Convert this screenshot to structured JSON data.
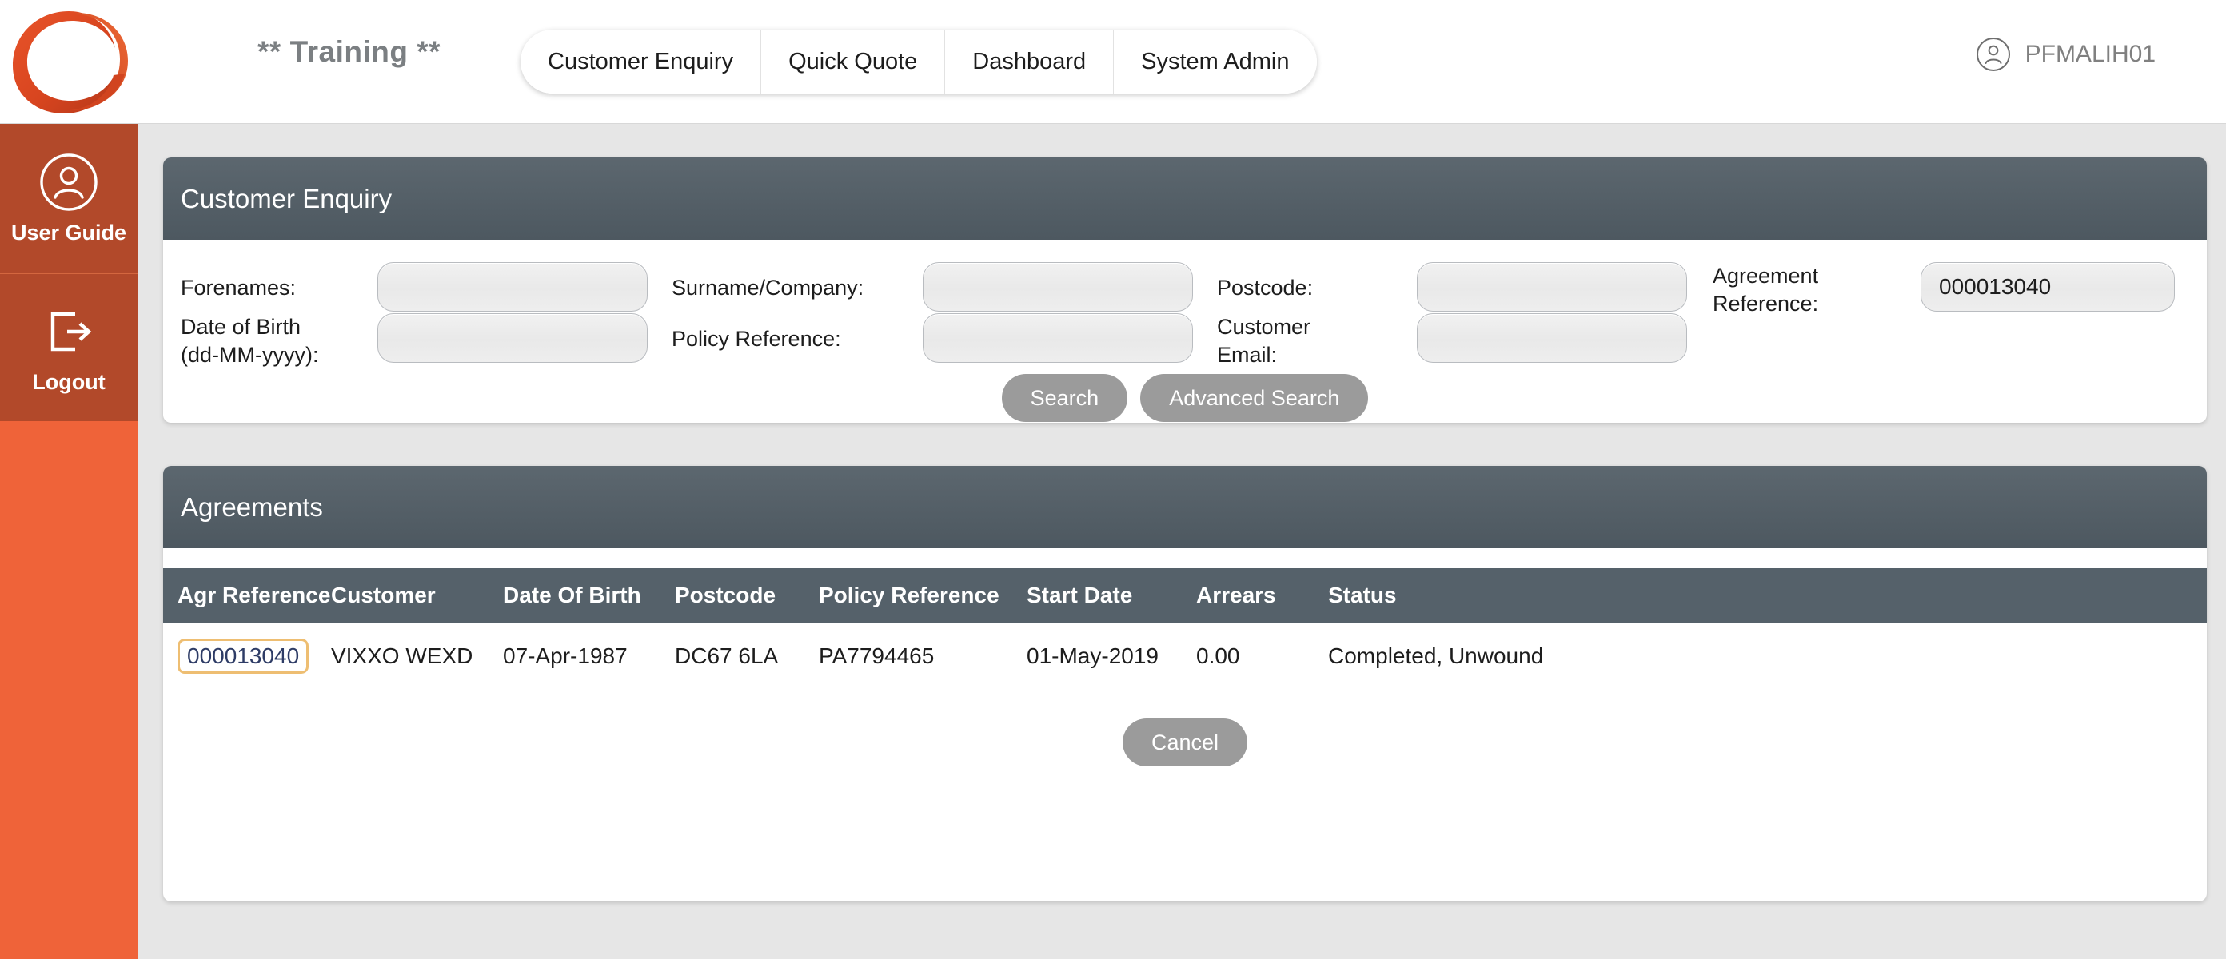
{
  "header": {
    "logo_icon": "swirl-ring-logo",
    "training_title": "** Training **",
    "tabs": [
      {
        "label": "Customer Enquiry"
      },
      {
        "label": "Quick Quote"
      },
      {
        "label": "Dashboard"
      },
      {
        "label": "System Admin"
      }
    ],
    "user": {
      "icon": "user-circle-icon",
      "name": "PFMALIH01"
    }
  },
  "sidebar": {
    "items": [
      {
        "label": "User Guide",
        "icon": "user-circle-icon"
      },
      {
        "label": "Logout",
        "icon": "logout-arrow-icon"
      }
    ],
    "background_color": "#ef6339",
    "item_color": "#b2492a"
  },
  "enquiry": {
    "title": "Customer Enquiry",
    "fields": [
      {
        "label": "Forenames:",
        "value": "",
        "placeholder": ""
      },
      {
        "label": "Surname/Company:",
        "value": "",
        "placeholder": ""
      },
      {
        "label": "Postcode:",
        "value": "",
        "placeholder": ""
      },
      {
        "label": "Agreement Reference:",
        "value": "000013040",
        "placeholder": ""
      },
      {
        "label": "Date of Birth (dd-MM-yyyy):",
        "value": "",
        "placeholder": ""
      },
      {
        "label": "Policy Reference:",
        "value": "",
        "placeholder": ""
      },
      {
        "label": "Customer Email:",
        "value": "",
        "placeholder": ""
      }
    ],
    "label_forenames": "Forenames:",
    "label_surname": "Surname/Company:",
    "label_postcode": "Postcode:",
    "label_agreement_1": "Agreement",
    "label_agreement_2": "Reference:",
    "label_dob_1": "Date of Birth",
    "label_dob_2": "(dd-MM-yyyy):",
    "label_policy": "Policy Reference:",
    "label_email_1": "Customer",
    "label_email_2": "Email:",
    "value_agreement_reference": "000013040",
    "search_button": "Search",
    "advanced_search_button": "Advanced Search"
  },
  "agreements": {
    "title": "Agreements",
    "columns": [
      "Agr Reference",
      "Customer",
      "Date Of Birth",
      "Postcode",
      "Policy Reference",
      "Start Date",
      "Arrears",
      "Status"
    ],
    "rows": [
      {
        "agr_reference": "000013040",
        "customer": "VIXXO WEXD",
        "date_of_birth": "07-Apr-1987",
        "postcode": "DC67 6LA",
        "policy_reference": "PA7794465",
        "start_date": "01-May-2019",
        "arrears": "0.00",
        "status": "Completed, Unwound"
      }
    ],
    "cancel_button": "Cancel",
    "link_focus_color": "#eebe72"
  }
}
